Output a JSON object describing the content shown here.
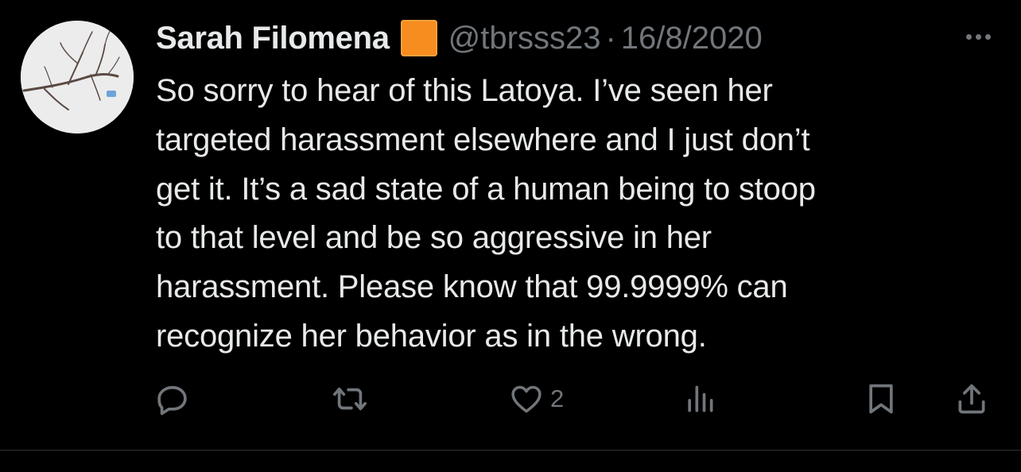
{
  "tweet": {
    "author": {
      "display_name": "Sarah Filomena",
      "badge_icon": "orange-square-emoji",
      "handle": "@tbrsss23",
      "avatar_icon": "branch-photo-avatar"
    },
    "separator": "·",
    "date": "16/8/2020",
    "text": "So sorry to hear of this Latoya. I’ve seen her\ntargeted harassment elsewhere and I just don’t\nget it. It’s a sad state of a human being to stoop\nto that level and be so aggressive in her\nharassment. Please know that 99.9999% can\nrecognize her behavior as in the wrong.",
    "actions": {
      "reply_icon": "reply-icon",
      "retweet_icon": "retweet-icon",
      "like_icon": "heart-icon",
      "like_count": "2",
      "views_icon": "analytics-icon",
      "bookmark_icon": "bookmark-icon",
      "share_icon": "share-icon"
    },
    "more_icon": "more-icon"
  },
  "colors": {
    "background": "#000000",
    "text_primary": "#e7e9ea",
    "text_secondary": "#71767b",
    "badge": "#f78c1f",
    "divider": "#2f3336"
  }
}
